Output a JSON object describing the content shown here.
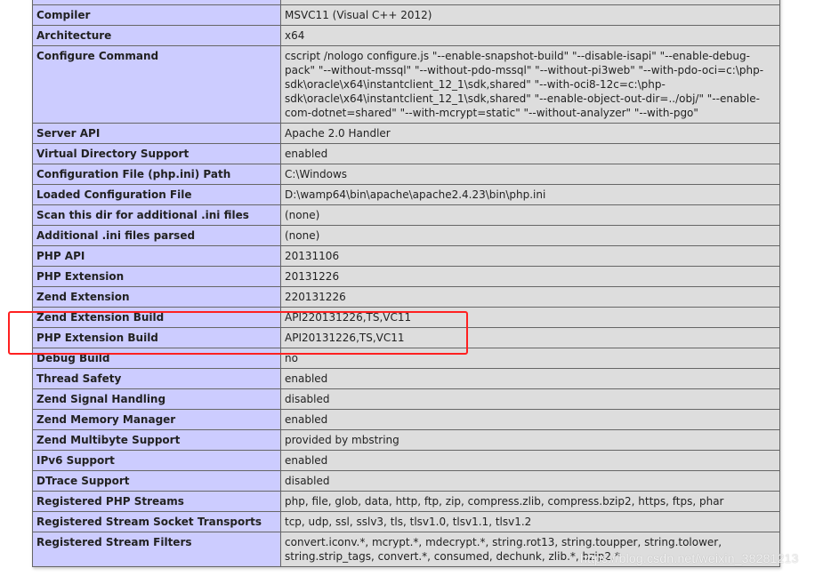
{
  "rows": [
    {
      "label": "",
      "value": ""
    },
    {
      "label": "Compiler",
      "value": "MSVC11 (Visual C++ 2012)"
    },
    {
      "label": "Architecture",
      "value": "x64"
    },
    {
      "label": "Configure Command",
      "value": "cscript /nologo configure.js \"--enable-snapshot-build\" \"--disable-isapi\" \"--enable-debug-pack\" \"--without-mssql\" \"--without-pdo-mssql\" \"--without-pi3web\" \"--with-pdo-oci=c:\\php-sdk\\oracle\\x64\\instantclient_12_1\\sdk,shared\" \"--with-oci8-12c=c:\\php-sdk\\oracle\\x64\\instantclient_12_1\\sdk,shared\" \"--enable-object-out-dir=../obj/\" \"--enable-com-dotnet=shared\" \"--with-mcrypt=static\" \"--without-analyzer\" \"--with-pgo\""
    },
    {
      "label": "Server API",
      "value": "Apache 2.0 Handler"
    },
    {
      "label": "Virtual Directory Support",
      "value": "enabled"
    },
    {
      "label": "Configuration File (php.ini) Path",
      "value": "C:\\Windows"
    },
    {
      "label": "Loaded Configuration File",
      "value": "D:\\wamp64\\bin\\apache\\apache2.4.23\\bin\\php.ini"
    },
    {
      "label": "Scan this dir for additional .ini files",
      "value": "(none)"
    },
    {
      "label": "Additional .ini files parsed",
      "value": "(none)"
    },
    {
      "label": "PHP API",
      "value": "20131106"
    },
    {
      "label": "PHP Extension",
      "value": "20131226"
    },
    {
      "label": "Zend Extension",
      "value": "220131226"
    },
    {
      "label": "Zend Extension Build",
      "value": "API220131226,TS,VC11"
    },
    {
      "label": "PHP Extension Build",
      "value": "API20131226,TS,VC11"
    },
    {
      "label": "Debug Build",
      "value": "no"
    },
    {
      "label": "Thread Safety",
      "value": "enabled"
    },
    {
      "label": "Zend Signal Handling",
      "value": "disabled"
    },
    {
      "label": "Zend Memory Manager",
      "value": "enabled"
    },
    {
      "label": "Zend Multibyte Support",
      "value": "provided by mbstring"
    },
    {
      "label": "IPv6 Support",
      "value": "enabled"
    },
    {
      "label": "DTrace Support",
      "value": "disabled"
    },
    {
      "label": "Registered PHP Streams",
      "value": "php, file, glob, data, http, ftp, zip, compress.zlib, compress.bzip2, https, ftps, phar"
    },
    {
      "label": "Registered Stream Socket Transports",
      "value": "tcp, udp, ssl, sslv3, tls, tlsv1.0, tlsv1.1, tlsv1.2"
    },
    {
      "label": "Registered Stream Filters",
      "value": "convert.iconv.*, mcrypt.*, mdecrypt.*, string.rot13, string.toupper, string.tolower, string.strip_tags, convert.*, consumed, dechunk, zlib.*, bzip2.*"
    }
  ],
  "highlight_color": "#ff2020",
  "watermark": "https://blog.csdn.net/weixin_38281213"
}
